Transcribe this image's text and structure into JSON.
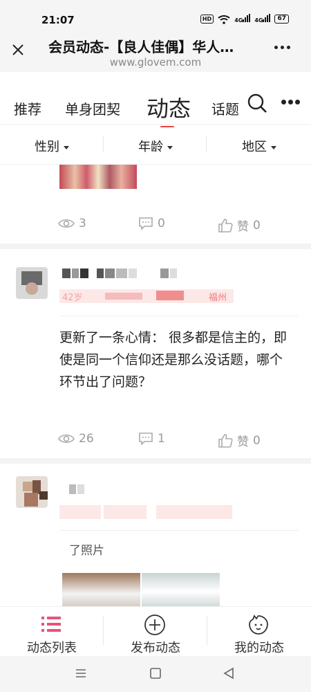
{
  "status": {
    "time": "21:07",
    "hd": "HD",
    "net1": "4G",
    "net2": "4G",
    "battery": "67"
  },
  "titlebar": {
    "title": "会员动态-【良人佳偶】华人…",
    "url": "www.glovem.com"
  },
  "tabs": {
    "items": [
      "推荐",
      "单身团契",
      "动态",
      "话题"
    ],
    "active": "动态"
  },
  "filters": {
    "gender": "性别",
    "age": "年龄",
    "region": "地区"
  },
  "posts": [
    {
      "views": "3",
      "comments": "0",
      "likes_label": "赞",
      "likes": "0"
    },
    {
      "tags": {
        "age": "42岁",
        "location": "福州"
      },
      "content": "更新了一条心情： 很多都是信主的，即使是同一个信仰还是那么没话题，哪个环节出了问题？",
      "views": "26",
      "comments": "1",
      "likes_label": "赞",
      "likes": "0"
    },
    {
      "content": "了照片"
    }
  ],
  "bottomnav": {
    "list": "动态列表",
    "publish": "发布动态",
    "mine": "我的动态"
  },
  "colors": {
    "accent": "#e8453c",
    "nav_active": "#e8537a",
    "tag_bg": "#fde8e8"
  }
}
